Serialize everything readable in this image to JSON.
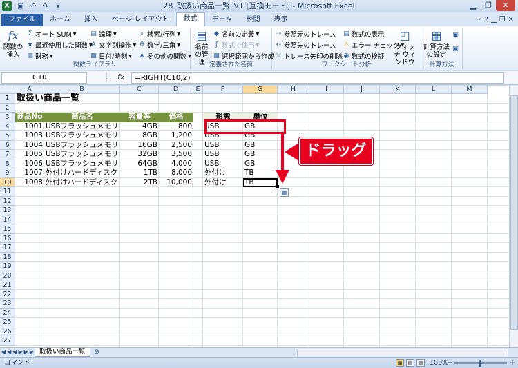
{
  "window": {
    "title": "28_取扱い商品一覧_V1 [互換モード] - Microsoft Excel",
    "app_icon": "X"
  },
  "tabs": [
    "ファイル",
    "ホーム",
    "挿入",
    "ページ レイアウト",
    "数式",
    "データ",
    "校閲",
    "表示"
  ],
  "active_tab": "数式",
  "ribbon": {
    "insert_function": "関数の挿入",
    "library": {
      "label": "関数ライブラリ",
      "autosum": "オート SUM",
      "recent": "最近使用した関数",
      "financial": "財務",
      "logical": "論理",
      "text": "文字列操作",
      "datetime": "日付/時刻",
      "lookup": "検索/行列",
      "math": "数学/三角",
      "more": "その他の関数"
    },
    "names": {
      "label": "定義された名前",
      "manager": "名前の管理",
      "define": "名前の定義",
      "use_in_formula": "数式で使用",
      "create": "選択範囲から作成"
    },
    "audit": {
      "label": "ワークシート分析",
      "trace_precedents": "参照元のトレース",
      "trace_dependents": "参照先のトレース",
      "remove_arrows": "トレース矢印の削除",
      "show_formulas": "数式の表示",
      "error_check": "エラー チェック",
      "evaluate": "数式の検証",
      "watch": "ウォッチ ウィンドウ"
    },
    "calc": {
      "label": "計算方法",
      "options": "計算方法の設定"
    }
  },
  "formula_bar": {
    "name_box": "G10",
    "fx": "fx",
    "formula": "=RIGHT(C10,2)"
  },
  "columns": [
    "A",
    "B",
    "C",
    "D",
    "E",
    "F",
    "G",
    "H",
    "I",
    "J",
    "K",
    "L",
    "M"
  ],
  "rows": [
    "1",
    "2",
    "3",
    "4",
    "5",
    "6",
    "7",
    "8",
    "9",
    "10",
    "11",
    "12",
    "13",
    "14",
    "15",
    "16",
    "17",
    "18",
    "19",
    "20",
    "21",
    "22",
    "23",
    "24",
    "25",
    "26",
    "27"
  ],
  "sheet": {
    "title": "取扱い商品一覧",
    "headers": [
      "商品No",
      "商品名",
      "容量等",
      "価格"
    ],
    "side_headers": [
      "形態",
      "単位"
    ],
    "products": [
      {
        "no": "1001",
        "name": "USBフラッシュメモリ",
        "cap": "4GB",
        "price": "800",
        "form": "USB",
        "unit": "GB"
      },
      {
        "no": "1003",
        "name": "USBフラッシュメモリ",
        "cap": "8GB",
        "price": "1,200",
        "form": "USB",
        "unit": "GB"
      },
      {
        "no": "1004",
        "name": "USBフラッシュメモリ",
        "cap": "16GB",
        "price": "2,500",
        "form": "USB",
        "unit": "GB"
      },
      {
        "no": "1005",
        "name": "USBフラッシュメモリ",
        "cap": "32GB",
        "price": "3,500",
        "form": "USB",
        "unit": "GB"
      },
      {
        "no": "1006",
        "name": "USBフラッシュメモリ",
        "cap": "64GB",
        "price": "4,000",
        "form": "USB",
        "unit": "GB"
      },
      {
        "no": "1007",
        "name": "外付けハードディスク",
        "cap": "1TB",
        "price": "8,000",
        "form": "外付け",
        "unit": "TB"
      },
      {
        "no": "1008",
        "name": "外付けハードディスク",
        "cap": "2TB",
        "price": "10,000",
        "form": "外付け",
        "unit": "TB"
      }
    ]
  },
  "annotation": {
    "label": "ドラッグ",
    "accent": "#e8001f"
  },
  "sheet_tab": "取扱い商品一覧",
  "status": {
    "mode": "コマンド",
    "zoom": "100%",
    "zoom_minus": "−",
    "zoom_plus": "+"
  },
  "colors": {
    "header_fill": "#76923c",
    "header_text": "#ffffff",
    "side_header_fill": "#ebf1de",
    "selection": "#000000"
  },
  "icons": [
    "excel-icon",
    "save-icon",
    "undo-icon",
    "redo-icon",
    "fx-icon",
    "sum-icon",
    "autofill-options-icon"
  ]
}
